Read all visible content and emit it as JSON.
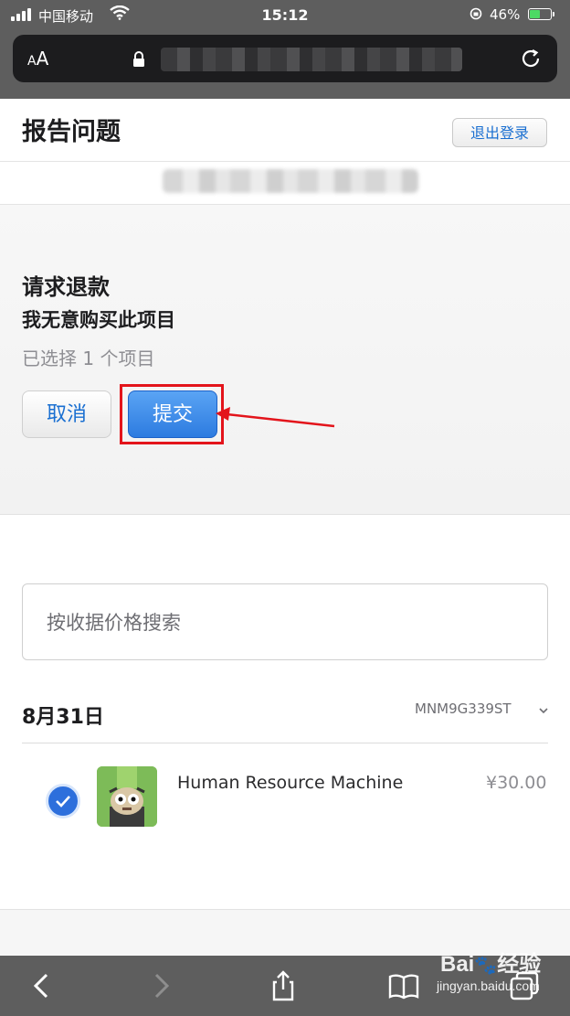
{
  "status_bar": {
    "carrier": "中国移动",
    "time": "15:12",
    "battery": "46%"
  },
  "browser": {
    "text_size_label_small": "A",
    "text_size_label_large": "A"
  },
  "header": {
    "title": "报告问题",
    "logout_label": "退出登录"
  },
  "refund": {
    "title": "请求退款",
    "reason": "我无意购买此项目",
    "selected_count": "已选择 1 个项目",
    "cancel_label": "取消",
    "submit_label": "提交"
  },
  "search": {
    "placeholder": "按收据价格搜索"
  },
  "order": {
    "date": "8月31日",
    "order_id": "MNM9G339ST",
    "items": [
      {
        "name": "Human Resource Machine",
        "price": "¥30.00",
        "selected": true
      }
    ]
  },
  "watermark": {
    "brand": "Bai",
    "brand_suffix": "经验",
    "url": "jingyan.baidu.com"
  },
  "colors": {
    "accent": "#1a6fd1",
    "submit": "#2d7be0",
    "annotation": "#e3141b",
    "chrome": "#5e5e5e"
  }
}
